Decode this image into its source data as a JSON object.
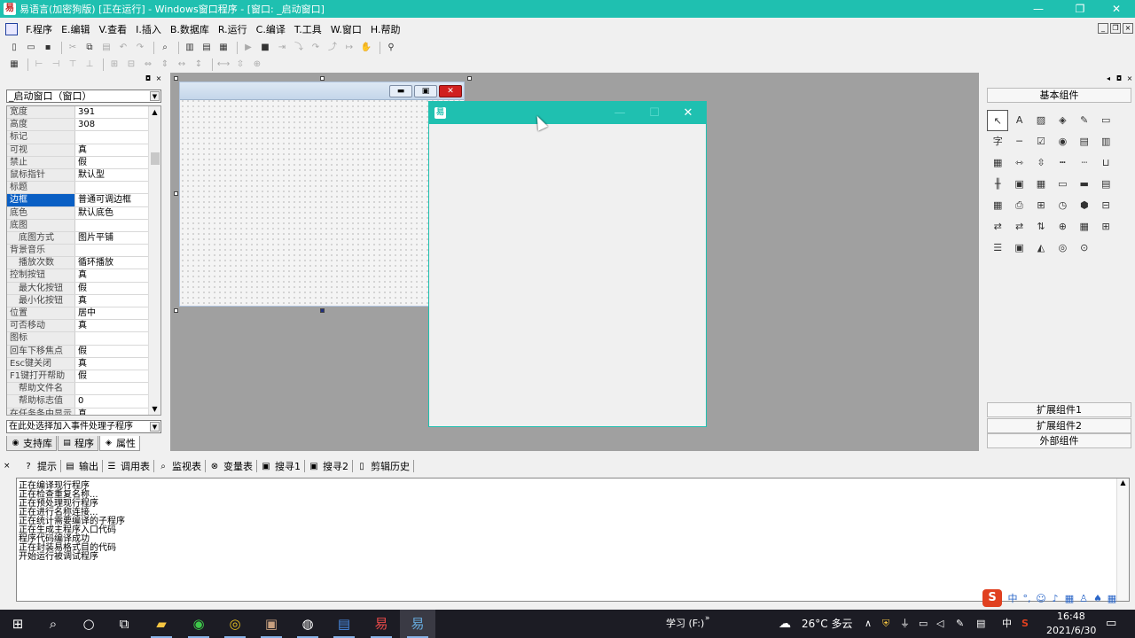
{
  "window": {
    "title": "易语言(加密狗版) [正在运行] - Windows窗口程序 - [窗口: _启动窗口]"
  },
  "menu": [
    "F.程序",
    "E.编辑",
    "V.查看",
    "I.插入",
    "B.数据库",
    "R.运行",
    "C.编译",
    "T.工具",
    "W.窗口",
    "H.帮助"
  ],
  "property_panel": {
    "object_selector": "_启动窗口（窗口）",
    "properties": [
      {
        "name": "宽度",
        "value": "391"
      },
      {
        "name": "高度",
        "value": "308"
      },
      {
        "name": "标记",
        "value": ""
      },
      {
        "name": "可视",
        "value": "真"
      },
      {
        "name": "禁止",
        "value": "假"
      },
      {
        "name": "鼠标指针",
        "value": "默认型"
      },
      {
        "name": "标题",
        "value": ""
      },
      {
        "name": "边框",
        "value": "普通可调边框",
        "selected": true
      },
      {
        "name": "底色",
        "value": "默认底色"
      },
      {
        "name": "底图",
        "value": ""
      },
      {
        "name": "底图方式",
        "value": "图片平铺",
        "sub": true
      },
      {
        "name": "背景音乐",
        "value": ""
      },
      {
        "name": "播放次数",
        "value": "循环播放",
        "sub": true
      },
      {
        "name": "控制按钮",
        "value": "真"
      },
      {
        "name": "最大化按钮",
        "value": "假",
        "sub": true
      },
      {
        "name": "最小化按钮",
        "value": "真",
        "sub": true
      },
      {
        "name": "位置",
        "value": "居中"
      },
      {
        "name": "可否移动",
        "value": "真"
      },
      {
        "name": "图标",
        "value": ""
      },
      {
        "name": "回车下移焦点",
        "value": "假"
      },
      {
        "name": "Esc键关闭",
        "value": "真"
      },
      {
        "name": "F1键打开帮助",
        "value": "假"
      },
      {
        "name": "帮助文件名",
        "value": "",
        "sub": true
      },
      {
        "name": "帮助标志值",
        "value": "0",
        "sub": true
      },
      {
        "name": "在任务条中显示",
        "value": "真"
      }
    ],
    "event_selector": "在此处选择加入事件处理子程序",
    "tabs": [
      "支持库",
      "程序",
      "属性"
    ],
    "active_tab": "属性"
  },
  "right_panel": {
    "header": "基本组件",
    "footer_buttons": [
      "扩展组件1",
      "扩展组件2",
      "外部组件"
    ]
  },
  "bottom_panel": {
    "tabs": [
      {
        "label": "提示",
        "icon": "?"
      },
      {
        "label": "输出",
        "icon": "▤"
      },
      {
        "label": "调用表",
        "icon": "☰"
      },
      {
        "label": "监视表",
        "icon": "⌕"
      },
      {
        "label": "变量表",
        "icon": "⊗"
      },
      {
        "label": "搜寻1",
        "icon": "▣"
      },
      {
        "label": "搜寻2",
        "icon": "▣"
      },
      {
        "label": "剪辑历史",
        "icon": "▯"
      }
    ],
    "output_lines": [
      "正在编译现行程序",
      "正在检查重复名称...",
      "正在预处理现行程序",
      "正在进行名称连接...",
      "正在统计需要编译的子程序",
      "正在生成主程序入口代码",
      "程序代码编译成功",
      "正在封装易格式目的代码",
      "开始运行被调试程序"
    ]
  },
  "taskbar": {
    "keyboard_label": "学习 (F:)",
    "weather": "26°C 多云",
    "ime": "中",
    "time": "16:48",
    "date": "2021/6/30"
  },
  "colors": {
    "accent": "#1fc0b0",
    "selection": "#0a5fc4",
    "designer_bg": "#a0a0a0",
    "taskbar": "#1c1c24"
  }
}
